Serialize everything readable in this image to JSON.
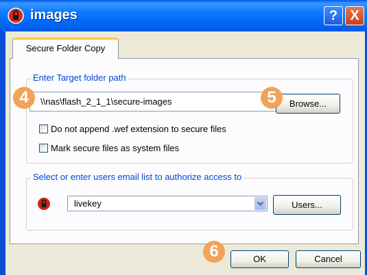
{
  "window": {
    "title": "images",
    "help_label": "?",
    "close_label": "X"
  },
  "tab": {
    "label": "Secure Folder Copy"
  },
  "target_group": {
    "legend": "Enter Target folder path",
    "path_value": "\\\\nas\\flash_2_1_1\\secure-images",
    "browse_label": "Browse...",
    "checkboxes": [
      {
        "label": "Do not append .wef extension to secure files",
        "checked": false
      },
      {
        "label": "Mark secure files as system files",
        "checked": false
      }
    ]
  },
  "users_group": {
    "legend": "Select or enter users email list to authorize access to",
    "selected_user": "livekey",
    "users_label": "Users..."
  },
  "footer": {
    "ok_label": "OK",
    "cancel_label": "Cancel"
  },
  "markers": [
    "4",
    "5",
    "6"
  ],
  "colors": {
    "titlebar": "#0058ee",
    "legend": "#0046d5",
    "marker": "#f0a35a",
    "dialog_bg": "#ece9d8"
  }
}
